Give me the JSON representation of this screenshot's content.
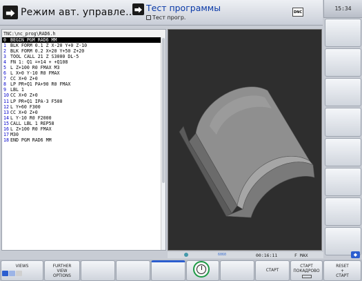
{
  "header": {
    "mode_main_label": "Режим авт. управле…",
    "mode_secondary_label": "Тест программы",
    "mode_secondary_sub": "Тест прогр.",
    "dnc_badge": "DNC",
    "mode_icon_glyph": "⮕"
  },
  "clock": "15:34",
  "program": {
    "path": "TNC:\\nc_prog\\RAD6.h",
    "lines": [
      {
        "n": "0",
        "text": "BEGIN PGM RAD6 MM"
      },
      {
        "n": "1",
        "text": "BLK FORM 0.1 Z X-20 Y+0 Z-10"
      },
      {
        "n": "2",
        "text": "BLK FORM 0.2  X+20  Y+50  Z+20"
      },
      {
        "n": "3",
        "text": "TOOL CALL 21 Z S3000 DL-5"
      },
      {
        "n": "4",
        "text": "FN 1: Q1 =+14 + +Q108"
      },
      {
        "n": "5",
        "text": "L  Z+100 R0 FMAX M3"
      },
      {
        "n": "6",
        "text": "L  X+0  Y-10 R0 FMAX"
      },
      {
        "n": "7",
        "text": "CC  X+0  Z+0"
      },
      {
        "n": "8",
        "text": "LP  PR+Q1  PA+90 R0 FMAX"
      },
      {
        "n": "9",
        "text": "LBL 1"
      },
      {
        "n": "10",
        "text": "CC  X+0  Z+0"
      },
      {
        "n": "11",
        "text": "LP  PR+Q1 IPA-3 F500"
      },
      {
        "n": "12",
        "text": "L  Y+60 F300"
      },
      {
        "n": "13",
        "text": "CC  X+0  Z+0"
      },
      {
        "n": "14",
        "text": "L  Y-10 R0 F2000"
      },
      {
        "n": "15",
        "text": "CALL LBL 1 REP58"
      },
      {
        "n": "16",
        "text": "L  Z+100 R0 FMAX"
      },
      {
        "n": "17",
        "text": "M30"
      },
      {
        "n": "18",
        "text": "END PGM RAD6 MM"
      }
    ]
  },
  "status": {
    "time": "00:16:11",
    "feed": "F MAX",
    "indicator": "6060"
  },
  "softkeys": {
    "views": "VIEWS",
    "further_1": "FURTHER",
    "further_2": "VIEW",
    "further_3": "OPTIONS",
    "start": "СТАРТ",
    "start_single_1": "СТАРТ",
    "start_single_2": "ПОКАДРОВО",
    "reset_1": "RESET",
    "reset_2": "+",
    "reset_3": "СТАРТ"
  },
  "colors": {
    "line_number": "#0000cc",
    "active_line_bg": "#000000",
    "graphic_bg": "#2f2f2f",
    "accent_blue": "#2c5ecf",
    "progress_green": "#1c9a44"
  }
}
